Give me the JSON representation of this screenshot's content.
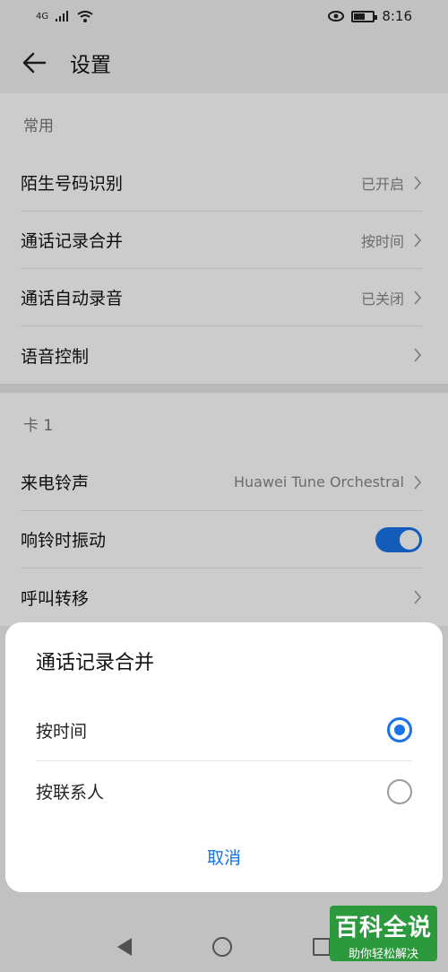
{
  "status": {
    "network": "4G",
    "time": "8:16",
    "battery_level": 0.6
  },
  "appbar": {
    "title": "设置"
  },
  "sections": [
    {
      "header": "常用",
      "rows": [
        {
          "label": "陌生号码识别",
          "value": "已开启"
        },
        {
          "label": "通话记录合并",
          "value": "按时间"
        },
        {
          "label": "通话自动录音",
          "value": "已关闭"
        },
        {
          "label": "语音控制",
          "value": ""
        }
      ]
    },
    {
      "header": "卡 1",
      "rows": [
        {
          "label": "来电铃声",
          "value": "Huawei Tune Orchestral"
        },
        {
          "label": "响铃时振动",
          "toggle": true
        },
        {
          "label": "呼叫转移",
          "value": ""
        }
      ]
    }
  ],
  "dialog": {
    "title": "通话记录合并",
    "options": [
      {
        "label": "按时间",
        "selected": true
      },
      {
        "label": "按联系人",
        "selected": false
      }
    ],
    "cancel_label": "取消"
  },
  "watermark": {
    "main": "百科全说",
    "sub": "助你轻松解决"
  },
  "colors": {
    "accent": "#1a73e8",
    "watermark_bg": "#2c9a3c"
  }
}
